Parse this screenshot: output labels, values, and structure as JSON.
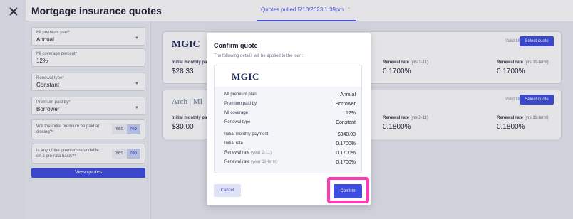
{
  "header": {
    "title": "Mortgage insurance quotes",
    "quotes_pulled": "Quotes pulled 5/10/2023 1:39pm",
    "chevron": "chevron-down-icon"
  },
  "sidebar": {
    "fields": [
      {
        "label": "MI premium plan*",
        "value": "Annual",
        "has_chevron": true
      },
      {
        "label": "MI coverage percent*",
        "value": "12%",
        "has_chevron": false
      },
      {
        "label": "Renewal type*",
        "value": "Constant",
        "has_chevron": true
      },
      {
        "label": "Premium paid by*",
        "value": "Borrower",
        "has_chevron": true
      }
    ],
    "questions": [
      {
        "text": "Will the initial premium be paid at closing?*",
        "yes": "Yes",
        "no": "No",
        "selected": "No"
      },
      {
        "text": "Is any of the premium refundable on a pro-rata basis?*",
        "yes": "Yes",
        "no": "No",
        "selected": "No"
      }
    ],
    "view_quotes": "View quotes"
  },
  "cards": [
    {
      "logo": "MGIC",
      "valid": "Valid till 08/07/2023",
      "select": "Select quote",
      "initial_label": "Initial monthly pay",
      "initial_value": "$28.33",
      "renewal1_label": "Renewal rate",
      "renewal1_suffix": "(yrs 2-11)",
      "renewal1_value": "0.1700%",
      "renewal2_label": "Renewal rate",
      "renewal2_suffix": "(yrs 11-term)",
      "renewal2_value": "0.1700%"
    },
    {
      "logo": "Arch | MI",
      "valid": "Valid till 08/07/2023",
      "select": "Select quote",
      "initial_label": "Initial monthly pay",
      "initial_value": "$30.00",
      "renewal1_label": "Renewal rate",
      "renewal1_suffix": "(yrs 2-11)",
      "renewal1_value": "0.1800%",
      "renewal2_label": "Renewal rate",
      "renewal2_suffix": "(yrs 11-term)",
      "renewal2_value": "0.1800%"
    }
  ],
  "modal": {
    "title": "Confirm quote",
    "subtitle": "The following details will be applied to the loan:",
    "logo": "MGIC",
    "rows": [
      {
        "label": "MI premium plan",
        "suffix": "",
        "value": "Annual"
      },
      {
        "label": "Premium paid by",
        "suffix": "",
        "value": "Borrower"
      },
      {
        "label": "MI coverage",
        "suffix": "",
        "value": "12%"
      },
      {
        "label": "Renewal type",
        "suffix": "",
        "value": "Constant"
      },
      {
        "label": "Initial monthly payment",
        "suffix": "",
        "value": "$340.00"
      },
      {
        "label": "Initial rate",
        "suffix": "",
        "value": "0.1700%"
      },
      {
        "label": "Renewal rate",
        "suffix": "(year 2-11)",
        "value": "0.1700%"
      },
      {
        "label": "Renewal rate",
        "suffix": "(year 11-term)",
        "value": "0.1700%"
      }
    ],
    "cancel": "Cancel",
    "confirm": "Confirm"
  },
  "colors": {
    "accent": "#3f4de0",
    "highlight": "#ff39b8"
  }
}
